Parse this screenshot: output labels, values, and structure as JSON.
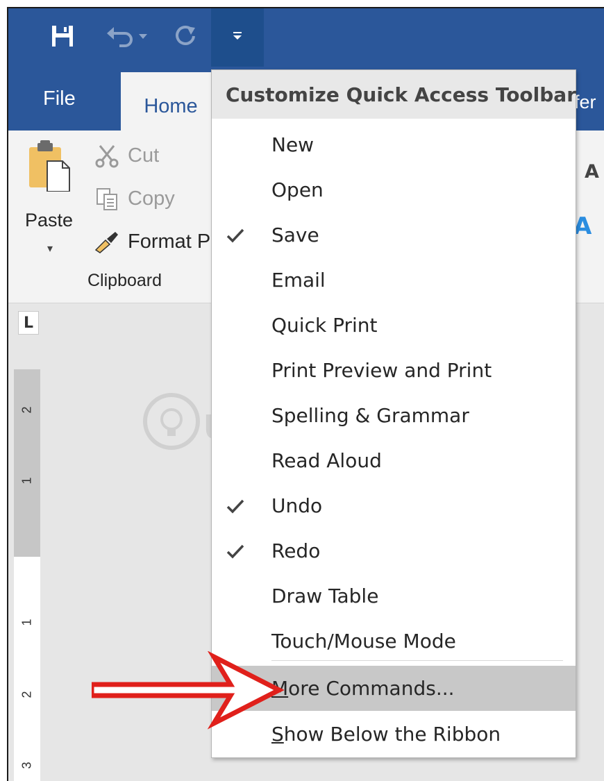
{
  "tabs": {
    "file": "File",
    "home": "Home",
    "references_partial": "efer"
  },
  "clipboard": {
    "paste": "Paste",
    "cut": "Cut",
    "copy": "Copy",
    "format_painter": "Format P",
    "group_label": "Clipboard"
  },
  "ribbon_right": {
    "font_glyph_1": "A",
    "font_glyph_2": "A"
  },
  "ruler": {
    "corner": "L",
    "marks": [
      "2",
      "1",
      "1",
      "2",
      "3"
    ]
  },
  "watermark": {
    "text": "uantrimang"
  },
  "menu": {
    "title": "Customize Quick Access Toolbar",
    "items": [
      {
        "label": "New",
        "checked": false
      },
      {
        "label": "Open",
        "checked": false
      },
      {
        "label": "Save",
        "checked": true
      },
      {
        "label": "Email",
        "checked": false
      },
      {
        "label": "Quick Print",
        "checked": false
      },
      {
        "label": "Print Preview and Print",
        "checked": false
      },
      {
        "label": "Spelling & Grammar",
        "checked": false
      },
      {
        "label": "Read Aloud",
        "checked": false
      },
      {
        "label": "Undo",
        "checked": true
      },
      {
        "label": "Redo",
        "checked": true
      },
      {
        "label": "Draw Table",
        "checked": false
      },
      {
        "label": "Touch/Mouse Mode",
        "checked": false
      }
    ],
    "more_commands": {
      "accel": "M",
      "rest": "ore Commands..."
    },
    "show_below": {
      "accel": "S",
      "rest": "how Below the Ribbon"
    }
  },
  "colors": {
    "title_bar": "#2b579a",
    "highlight": "#c8c8c8",
    "arrow": "#e0201b"
  }
}
